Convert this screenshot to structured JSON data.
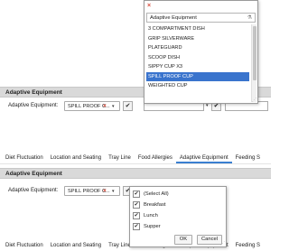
{
  "panel1": {
    "header": "Adaptive Equipment",
    "field_label": "Adaptive Equipment:",
    "select_value": "SPILL PROOF C...",
    "popup": {
      "search_text": "Adaptive Equipment",
      "items": [
        "3 COMPARTMENT DISH",
        "GRIP SILVERWARE",
        "PLATEGUARD",
        "SCOOP DISH",
        "SIPPY CUP X3",
        "SPILL PROOF CUP",
        "WEIGHTED CUP"
      ],
      "selected_index": 5
    },
    "tabs": [
      "Diet Fluctuation",
      "Location and Seating",
      "Tray Line",
      "Food Allergies",
      "Adaptive Equipment",
      "Feeding S"
    ],
    "active_tab": 4
  },
  "panel2": {
    "header": "Adaptive Equipment",
    "field_label": "Adaptive Equipment:",
    "select_value": "SPILL PROOF C...",
    "checklist": {
      "items": [
        {
          "label": "(Select All)",
          "checked": true
        },
        {
          "label": "Breakfast",
          "checked": true
        },
        {
          "label": "Lunch",
          "checked": true
        },
        {
          "label": "Supper",
          "checked": true
        }
      ],
      "ok_label": "OK",
      "cancel_label": "Cancel"
    },
    "tabs": [
      "Diet Fluctuation",
      "Location and Seating",
      "Tray Line",
      "Food Allergies",
      "Adaptive Equipment",
      "Feeding S"
    ]
  },
  "glyphs": {
    "close": "×",
    "check": "✔",
    "arrow_down": "▾",
    "filter": "⚗",
    "resize": "⋰"
  },
  "colors": {
    "accent": "#3a74cd",
    "clear_x": "#d94a3a",
    "header_bg": "#d9d9d9"
  }
}
